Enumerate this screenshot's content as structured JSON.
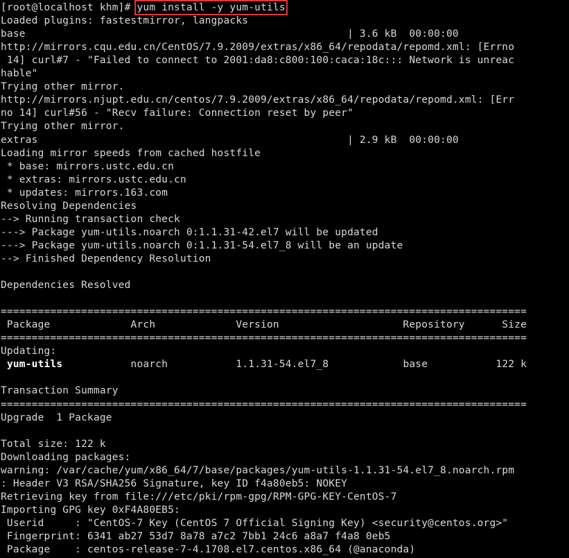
{
  "terminal": {
    "prompt": "[root@localhost khm]# ",
    "command": "yum install -y yum-utils",
    "lines": [
      "Loaded plugins: fastestmirror, langpacks",
      "base                                                    | 3.6 kB  00:00:00",
      "http://mirrors.cqu.edu.cn/CentOS/7.9.2009/extras/x86_64/repodata/repomd.xml: [Errno",
      " 14] curl#7 - \"Failed to connect to 2001:da8:c800:100:caca:18c::: Network is unreac",
      "hable\"",
      "Trying other mirror.",
      "http://mirrors.njupt.edu.cn/centos/7.9.2009/extras/x86_64/repodata/repomd.xml: [Err",
      "no 14] curl#56 - \"Recv failure: Connection reset by peer\"",
      "Trying other mirror.",
      "extras                                                  | 2.9 kB  00:00:00",
      "Loading mirror speeds from cached hostfile",
      " * base: mirrors.ustc.edu.cn",
      " * extras: mirrors.ustc.edu.cn",
      " * updates: mirrors.163.com",
      "Resolving Dependencies",
      "--> Running transaction check",
      "---> Package yum-utils.noarch 0:1.1.31-42.el7 will be updated",
      "---> Package yum-utils.noarch 0:1.1.31-54.el7_8 will be an update",
      "--> Finished Dependency Resolution",
      "",
      "Dependencies Resolved",
      "",
      "=====================================================================================",
      " Package             Arch             Version                    Repository      Size",
      "=====================================================================================",
      "Updating:",
      "__ROW__",
      "",
      "Transaction Summary",
      "=====================================================================================",
      "Upgrade  1 Package",
      "",
      "Total size: 122 k",
      "Downloading packages:",
      "warning: /var/cache/yum/x86_64/7/base/packages/yum-utils-1.1.31-54.el7_8.noarch.rpm",
      ": Header V3 RSA/SHA256 Signature, key ID f4a80eb5: NOKEY",
      "Retrieving key from file:///etc/pki/rpm-gpg/RPM-GPG-KEY-CentOS-7",
      "Importing GPG key 0xF4A80EB5:",
      " Userid     : \"CentOS-7 Key (CentOS 7 Official Signing Key) <security@centos.org>\"",
      " Fingerprint: 6341 ab27 53d7 8a78 a7c2 7bb1 24c6 a8a7 f4a8 0eb5",
      " Package    : centos-release-7-4.1708.el7.centos.x86_64 (@anaconda)"
    ],
    "package_row": {
      "name": "yum-utils",
      "rest": "           noarch           1.1.31-54.el7_8            base           122 k"
    },
    "colors": {
      "background": "#000000",
      "foreground": "#d9d9d9",
      "highlight_box": "#e0373a"
    }
  }
}
